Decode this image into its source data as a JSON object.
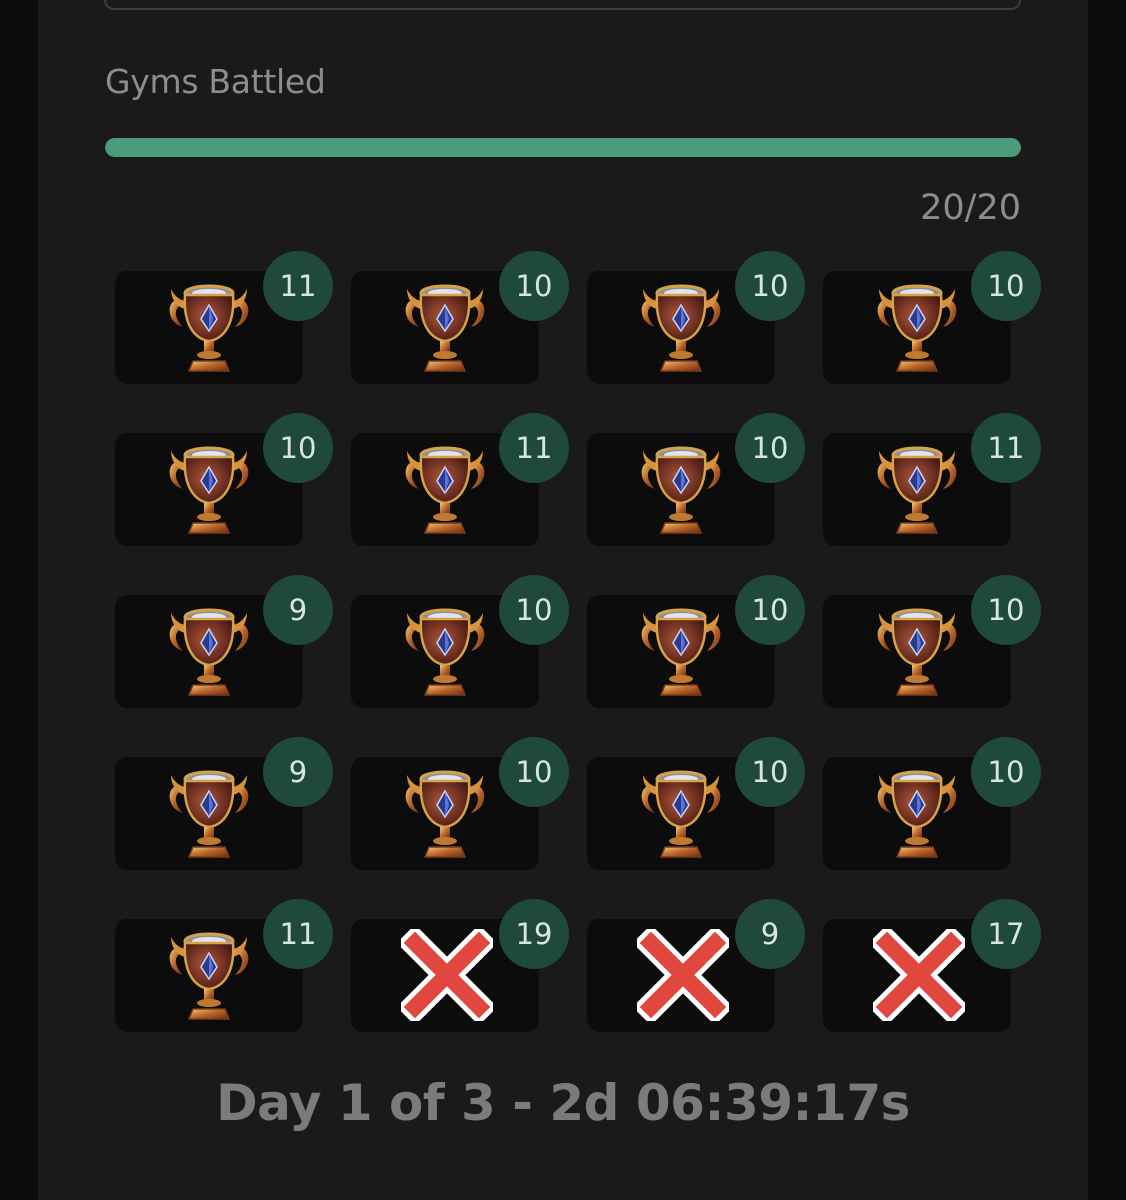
{
  "section": {
    "title": "Gyms Battled",
    "progress_fraction": 1.0,
    "progress_text": "20/20",
    "progress_color": "#4a9c7b"
  },
  "tiles": [
    {
      "count": "11",
      "status": "won",
      "icon": "trophy-icon"
    },
    {
      "count": "10",
      "status": "won",
      "icon": "trophy-icon"
    },
    {
      "count": "10",
      "status": "won",
      "icon": "trophy-icon"
    },
    {
      "count": "10",
      "status": "won",
      "icon": "trophy-icon"
    },
    {
      "count": "10",
      "status": "won",
      "icon": "trophy-icon"
    },
    {
      "count": "11",
      "status": "won",
      "icon": "trophy-icon"
    },
    {
      "count": "10",
      "status": "won",
      "icon": "trophy-icon"
    },
    {
      "count": "11",
      "status": "won",
      "icon": "trophy-icon"
    },
    {
      "count": "9",
      "status": "won",
      "icon": "trophy-icon"
    },
    {
      "count": "10",
      "status": "won",
      "icon": "trophy-icon"
    },
    {
      "count": "10",
      "status": "won",
      "icon": "trophy-icon"
    },
    {
      "count": "10",
      "status": "won",
      "icon": "trophy-icon"
    },
    {
      "count": "9",
      "status": "won",
      "icon": "trophy-icon"
    },
    {
      "count": "10",
      "status": "won",
      "icon": "trophy-icon"
    },
    {
      "count": "10",
      "status": "won",
      "icon": "trophy-icon"
    },
    {
      "count": "10",
      "status": "won",
      "icon": "trophy-icon"
    },
    {
      "count": "11",
      "status": "won",
      "icon": "trophy-icon"
    },
    {
      "count": "19",
      "status": "lost",
      "icon": "red-x-icon"
    },
    {
      "count": "9",
      "status": "lost",
      "icon": "red-x-icon"
    },
    {
      "count": "17",
      "status": "lost",
      "icon": "red-x-icon"
    }
  ],
  "footer": {
    "status_text": "Day 1 of 3 - 2d 06:39:17s"
  },
  "colors": {
    "badge": "#1f4a3a",
    "lost_mark": "#e2473f"
  }
}
